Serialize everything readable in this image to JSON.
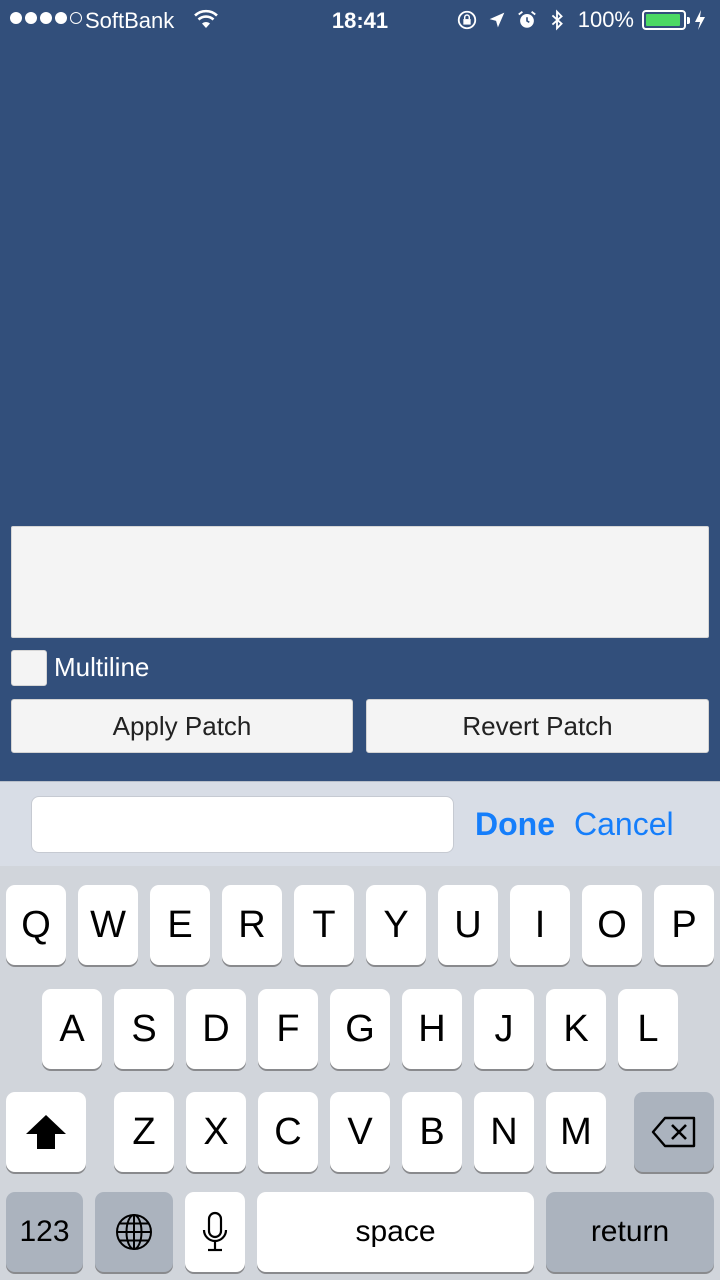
{
  "status_bar": {
    "carrier": "SoftBank",
    "time": "18:41",
    "battery_percent": "100%",
    "battery_level": 1.0,
    "signal_bars_filled": 4,
    "signal_bars_total": 5,
    "icons": [
      "wifi-icon",
      "orientation-lock-icon",
      "location-arrow-icon",
      "alarm-icon",
      "bluetooth-icon",
      "battery-icon",
      "charging-icon"
    ]
  },
  "form": {
    "text_area_value": "",
    "multiline_label": "Multiline",
    "multiline_checked": false,
    "apply_label": "Apply Patch",
    "revert_label": "Revert Patch"
  },
  "accessory": {
    "input_value": "",
    "done_label": "Done",
    "cancel_label": "Cancel"
  },
  "keyboard": {
    "row1": [
      "Q",
      "W",
      "E",
      "R",
      "T",
      "Y",
      "U",
      "I",
      "O",
      "P"
    ],
    "row2": [
      "A",
      "S",
      "D",
      "F",
      "G",
      "H",
      "J",
      "K",
      "L"
    ],
    "row3": [
      "Z",
      "X",
      "C",
      "V",
      "B",
      "N",
      "M"
    ],
    "numbers_label": "123",
    "space_label": "space",
    "return_label": "return"
  },
  "colors": {
    "background": "#324f7b",
    "accent": "#157efb",
    "battery_fill": "#4cd964"
  }
}
